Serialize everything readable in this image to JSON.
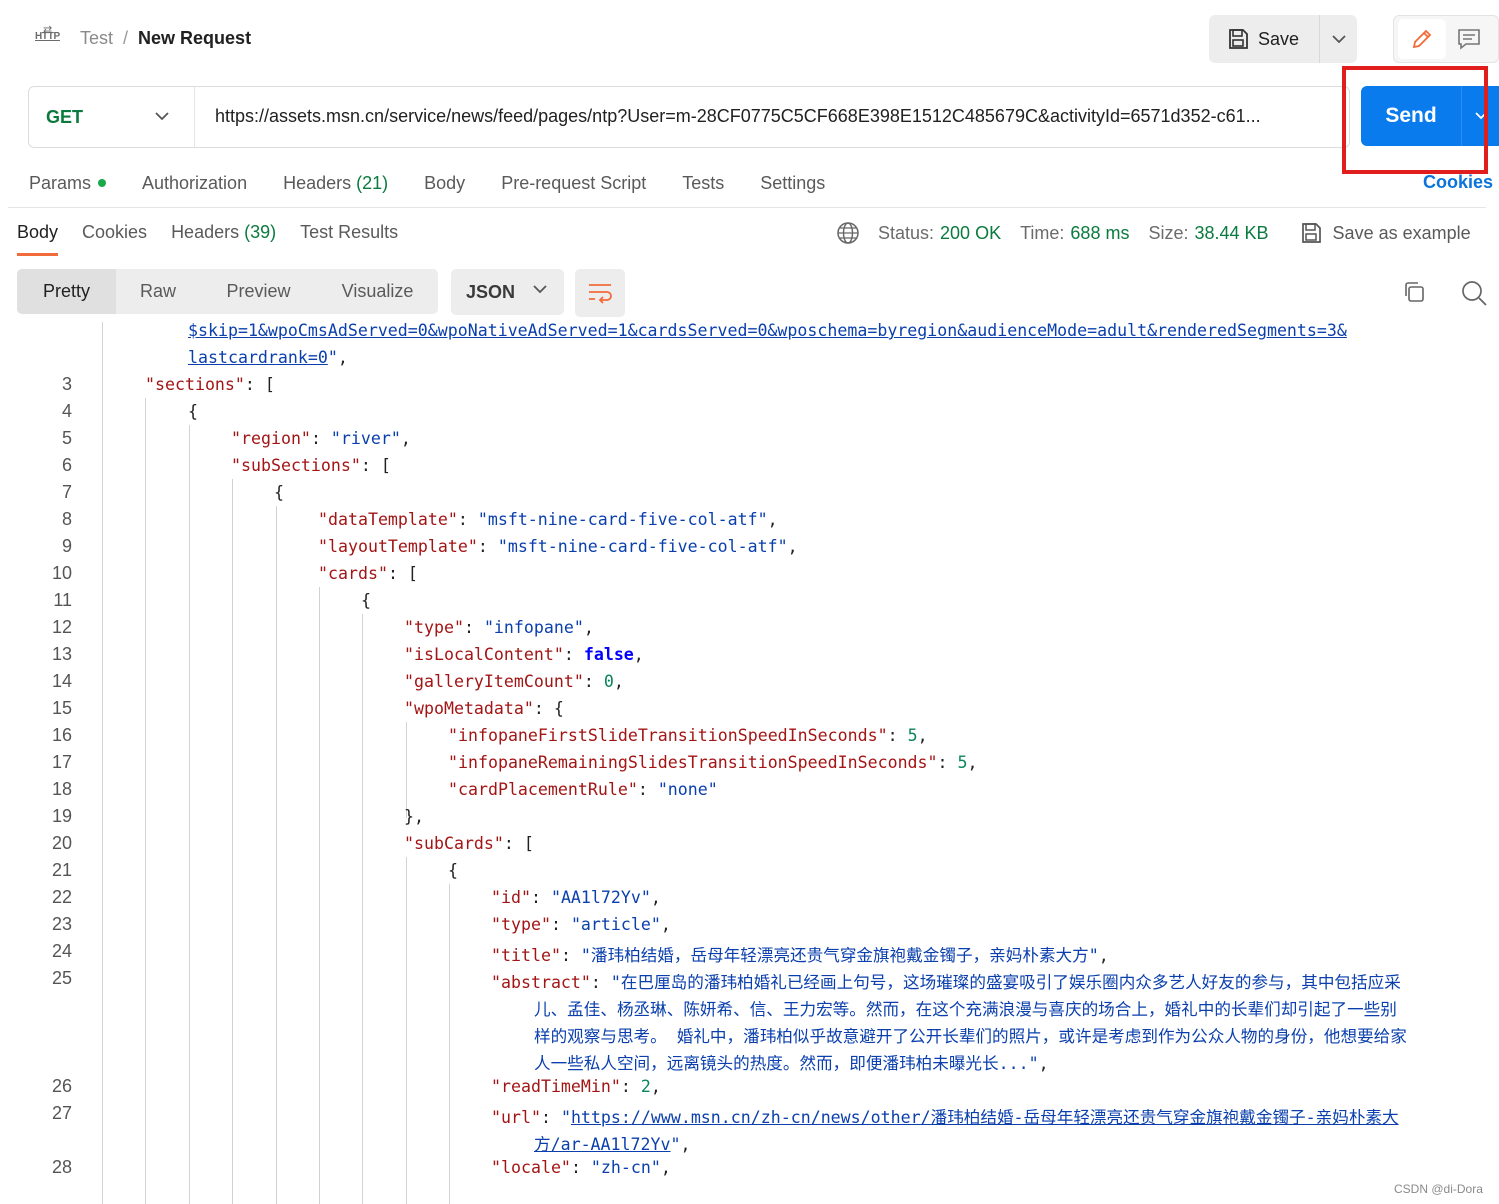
{
  "header": {
    "icon_label": "HTTP",
    "collection": "Test",
    "separator": "/",
    "request_name": "New Request",
    "save_label": "Save"
  },
  "request": {
    "method": "GET",
    "url": "https://assets.msn.cn/service/news/feed/pages/ntp?User=m-28CF0775C5CF668E398E1512C485679C&activityId=6571d352-c61...",
    "send_label": "Send"
  },
  "request_tabs": [
    {
      "label": "Params",
      "count": ""
    },
    {
      "label": "Authorization",
      "count": ""
    },
    {
      "label": "Headers",
      "count": "(21)"
    },
    {
      "label": "Body",
      "count": ""
    },
    {
      "label": "Pre-request Script",
      "count": ""
    },
    {
      "label": "Tests",
      "count": ""
    },
    {
      "label": "Settings",
      "count": ""
    }
  ],
  "cookies_link": "Cookies",
  "response_tabs": [
    {
      "label": "Body",
      "count": ""
    },
    {
      "label": "Cookies",
      "count": ""
    },
    {
      "label": "Headers",
      "count": "(39)"
    },
    {
      "label": "Test Results",
      "count": ""
    }
  ],
  "status": {
    "status_label": "Status:",
    "status_value": "200 OK",
    "time_label": "Time:",
    "time_value": "688 ms",
    "size_label": "Size:",
    "size_value": "38.44 KB",
    "save_example": "Save as example"
  },
  "view_modes": [
    "Pretty",
    "Raw",
    "Preview",
    "Visualize"
  ],
  "format": "JSON",
  "code": {
    "wrap1": "$skip=1&wpoCmsAdServed=0&wpoNativeAdServed=1&cardsServed=0&wposchema=byregion&audienceMode=adult&renderedSegments=3&",
    "wrap2": "lastcardrank=0",
    "abstract_1": "\"在巴厘岛的潘玮柏婚礼已经画上句号，这场璀璨的盛宴吸引了娱乐圈内众多艺人好友的参与，其中包括应采",
    "abstract_2": "儿、孟佳、杨丞琳、陈妍希、信、王力宏等。然而，在这个充满浪漫与喜庆的场合上，婚礼中的长辈们却引起了一些别",
    "abstract_3": "样的观察与思考。 婚礼中，潘玮柏似乎故意避开了公开长辈们的照片，或许是考虑到作为公众人物的身份，他想要给家",
    "abstract_4": "人一些私人空间，远离镜头的热度。然而，即便潘玮柏未曝光长...\"",
    "title_value": "\"潘玮柏结婚，岳母年轻漂亮还贵气穿金旗袍戴金镯子，亲妈朴素大方\"",
    "url_1": "https://www.msn.cn/zh-cn/news/other/潘玮柏结婚-岳母年轻漂亮还贵气穿金旗袍戴金镯子-亲妈朴素大",
    "url_2": "方/ar-AA1l72Yv"
  },
  "watermark": "CSDN @di-Dora"
}
